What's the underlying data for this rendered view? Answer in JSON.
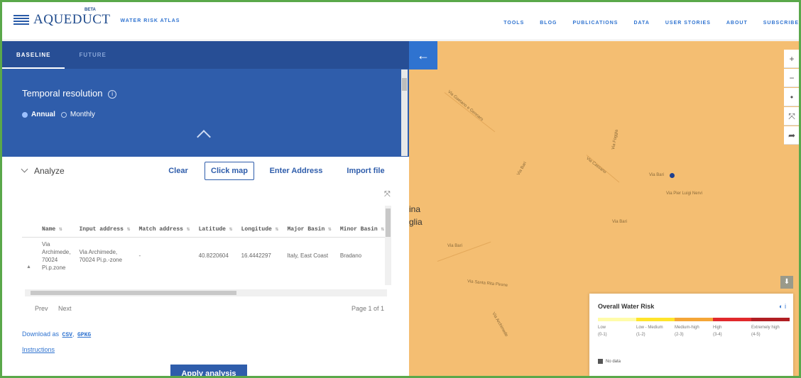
{
  "header": {
    "logo_name": "AQUEDUCT",
    "beta": "BETA",
    "tagline": "WATER RISK ATLAS",
    "nav": [
      "TOOLS",
      "BLOG",
      "PUBLICATIONS",
      "DATA",
      "USER STORIES",
      "ABOUT",
      "SUBSCRIBE"
    ]
  },
  "tabs": {
    "baseline": "BASELINE",
    "future": "FUTURE"
  },
  "temporal": {
    "label": "Temporal resolution",
    "annual": "Annual",
    "monthly": "Monthly",
    "selected": "Annual"
  },
  "analyze": {
    "label": "Analyze",
    "clear": "Clear",
    "click_map": "Click map",
    "enter_address": "Enter Address",
    "import_file": "Import file"
  },
  "table": {
    "headers": [
      "Name",
      "Input address",
      "Match address",
      "Latitude",
      "Longitude",
      "Major Basin",
      "Minor Basin"
    ],
    "row": {
      "name": "Via Archimede, 70024 Pi.p.zone",
      "input_address": "Via Archimede, 70024 Pi.p.-zone",
      "match_address": "-",
      "latitude": "40.8220604",
      "longitude": "16.4442297",
      "major_basin": "Italy, East Coast",
      "minor_basin": "Bradano"
    }
  },
  "pager": {
    "prev": "Prev",
    "next": "Next",
    "page": "Page 1 of 1"
  },
  "download": {
    "label": "Download as",
    "csv": "CSV",
    "gpkg": "GPKG"
  },
  "instructions": "Instructions",
  "apply": "Apply analysis",
  "map": {
    "city_labels": [
      "ina",
      "glia"
    ],
    "street_labels": [
      "Via Gaetano e Gennaro",
      "Via Cassano",
      "Via Foggia",
      "Via Bari",
      "Via Pier Luigi Nervi",
      "Via Bari",
      "Via Santa Rita Pirone",
      "Via Bari",
      "Via Bari",
      "Via Archimede"
    ]
  },
  "legend": {
    "title": "Overall Water Risk",
    "categories": [
      {
        "name": "Low",
        "range": "(0-1)"
      },
      {
        "name": "Low - Medium",
        "range": "(1-2)"
      },
      {
        "name": "Medium-high",
        "range": "(2-3)"
      },
      {
        "name": "High",
        "range": "(3-4)"
      },
      {
        "name": "Extremely high",
        "range": "(4-5)"
      }
    ],
    "colors": [
      "#fffcaa",
      "#ffe42b",
      "#f4a637",
      "#e1292c",
      "#b01e23"
    ],
    "no_data": "No data"
  }
}
